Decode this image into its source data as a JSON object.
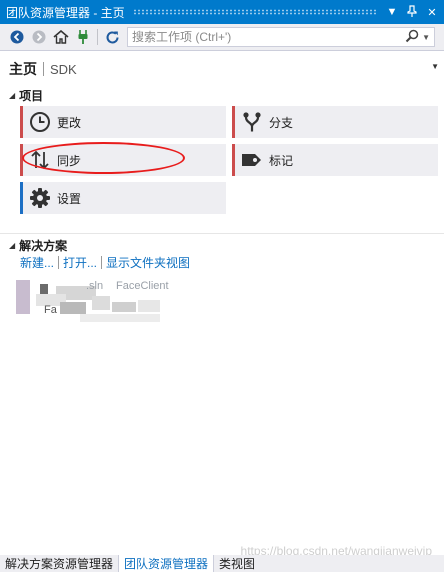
{
  "window": {
    "title": "团队资源管理器 - 主页"
  },
  "toolbar": {
    "search_placeholder": "搜索工作项 (Ctrl+')"
  },
  "page": {
    "title": "主页",
    "subtitle": "SDK"
  },
  "project_section": {
    "title": "项目",
    "tiles": [
      {
        "label": "更改",
        "icon": "clock-icon",
        "accent": "#cc4c4c"
      },
      {
        "label": "分支",
        "icon": "branch-icon",
        "accent": "#cc4c4c"
      },
      {
        "label": "同步",
        "icon": "sync-arrows-icon",
        "accent": "#cc4c4c"
      },
      {
        "label": "标记",
        "icon": "tag-icon",
        "accent": "#cc4c4c"
      },
      {
        "label": "设置",
        "icon": "gear-icon",
        "accent": "#1c6fc4"
      }
    ]
  },
  "solution_section": {
    "title": "解决方案",
    "links": [
      "新建...",
      "打开...",
      "显示文件夹视图"
    ],
    "item_fragments": [
      ".sln",
      "FaceClient",
      "Fa"
    ]
  },
  "bottom_tabs": [
    {
      "label": "解决方案资源管理器",
      "active": false
    },
    {
      "label": "团队资源管理器",
      "active": true
    },
    {
      "label": "类视图",
      "active": false
    }
  ],
  "watermark": "https://blog.csdn.net/wangjianweivip",
  "colors": {
    "accent_blue": "#007acc",
    "link_blue": "#0e70c0",
    "highlight_red": "#e81c1c"
  }
}
